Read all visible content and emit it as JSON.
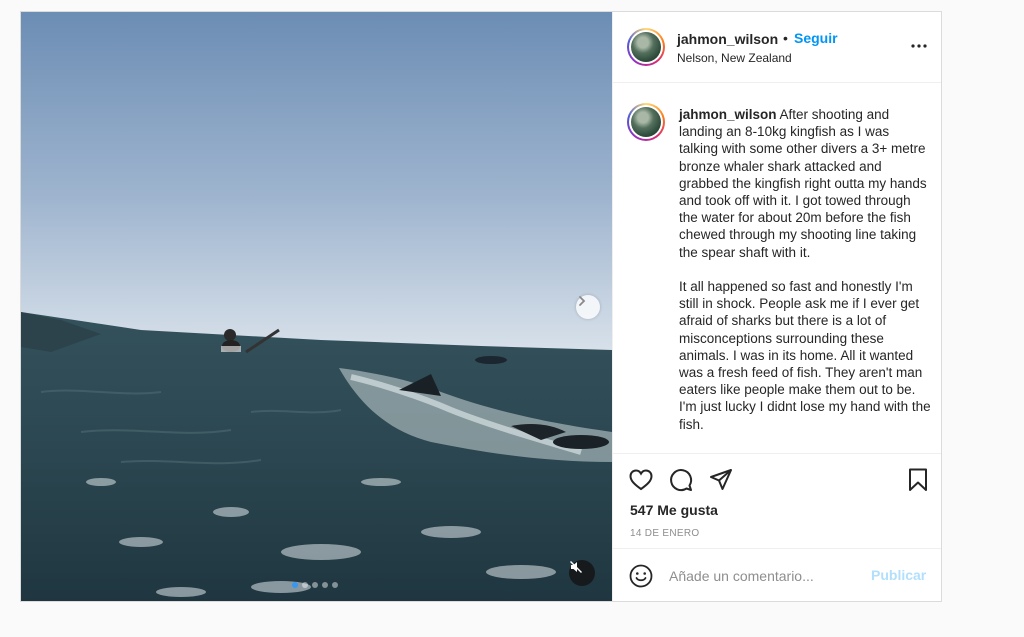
{
  "post": {
    "username": "jahmon_wilson",
    "follow_label": "Seguir",
    "bullet": "•",
    "location": "Nelson, New Zealand",
    "caption": "After shooting and landing an 8-10kg kingfish as I was talking with some other divers a 3+ metre bronze whaler shark attacked and grabbed the kingfish right outta my hands and took off with it. I got towed through the water for about 20m before the fish chewed through my shooting line taking the spear shaft with it.\n\nIt all happened so fast and honestly I'm still in shock. People ask me if I ever get afraid of sharks but there is a lot of misconceptions surrounding these animals. I was in its home. All it wanted was a fresh feed of fish. They aren't man eaters like people make them out to be. I'm just lucky I didnt lose my hand with the fish.",
    "likes": "547 Me gusta",
    "date": "14 DE ENERO",
    "comment_placeholder": "Añade un comentario...",
    "publish_label": "Publicar"
  },
  "media": {
    "slide_count": 5,
    "active_slide": 1
  },
  "icons": {
    "more": "more-options-icon",
    "like": "heart-icon",
    "comment": "comment-icon",
    "share": "paper-plane-icon",
    "save": "bookmark-icon",
    "emoji": "emoji-icon",
    "next": "chevron-right-icon",
    "mute": "muted-speaker-icon"
  },
  "colors": {
    "link_blue": "#0095f6",
    "publish_disabled": "#b2dffc",
    "secondary_text": "#8e8e8e"
  }
}
